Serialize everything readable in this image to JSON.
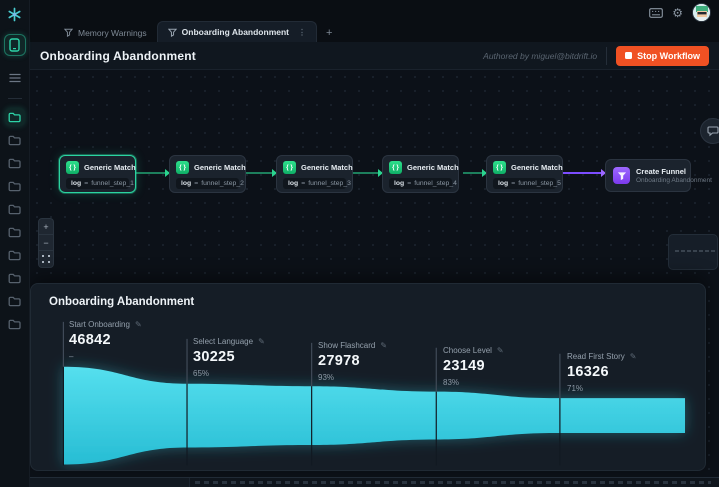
{
  "icons": {
    "braces": "{ }",
    "pencil": "✎",
    "kebab": "⋮",
    "plus": "+",
    "minus": "−",
    "new_tab": "+"
  },
  "tabs": {
    "items": [
      {
        "label": "Memory Warnings",
        "active": false
      },
      {
        "label": "Onboarding Abandonment",
        "active": true
      }
    ]
  },
  "header": {
    "title": "Onboarding Abandonment",
    "authored_by": "Authored by miguel@bitdrift.io",
    "stop_button": "Stop Workflow"
  },
  "canvas": {
    "nodes": [
      {
        "title": "Generic Match",
        "field": "log",
        "operator": "=",
        "value": "funnel_step_1",
        "selected": true
      },
      {
        "title": "Generic Match",
        "field": "log",
        "operator": "=",
        "value": "funnel_step_2",
        "selected": false
      },
      {
        "title": "Generic Match",
        "field": "log",
        "operator": "=",
        "value": "funnel_step_3",
        "selected": false
      },
      {
        "title": "Generic Match",
        "field": "log",
        "operator": "=",
        "value": "funnel_step_4",
        "selected": false
      },
      {
        "title": "Generic Match",
        "field": "log",
        "operator": "=",
        "value": "funnel_step_5",
        "selected": false
      }
    ],
    "output_node": {
      "title": "Create Funnel",
      "subtitle": "Onboarding Abandonment"
    }
  },
  "funnel_panel": {
    "title": "Onboarding Abandonment",
    "stages": [
      {
        "label": "Start Onboarding",
        "value": "46842",
        "pct": "–"
      },
      {
        "label": "Select Language",
        "value": "30225",
        "pct": "65%"
      },
      {
        "label": "Show Flashcard",
        "value": "27978",
        "pct": "93%"
      },
      {
        "label": "Choose Level",
        "value": "23149",
        "pct": "83%"
      },
      {
        "label": "Read First Story",
        "value": "16326",
        "pct": "71%"
      }
    ]
  },
  "chart_data": {
    "type": "area",
    "title": "Onboarding Abandonment",
    "categories": [
      "Start Onboarding",
      "Select Language",
      "Show Flashcard",
      "Choose Level",
      "Read First Story"
    ],
    "values": [
      46842,
      30225,
      27978,
      23149,
      16326
    ],
    "conversion_pct": [
      null,
      65,
      93,
      83,
      71
    ],
    "accent_color": "#3fd8e8",
    "legend": "none",
    "grid": "off"
  },
  "colors": {
    "accent_teal": "#2dd4a8",
    "funnel_top": "#55dfee",
    "funnel_bottom": "#27bdd4",
    "stop_orange": "#f05123",
    "edge_green": "#1d7f5c",
    "edge_purple": "#7c4dff"
  }
}
